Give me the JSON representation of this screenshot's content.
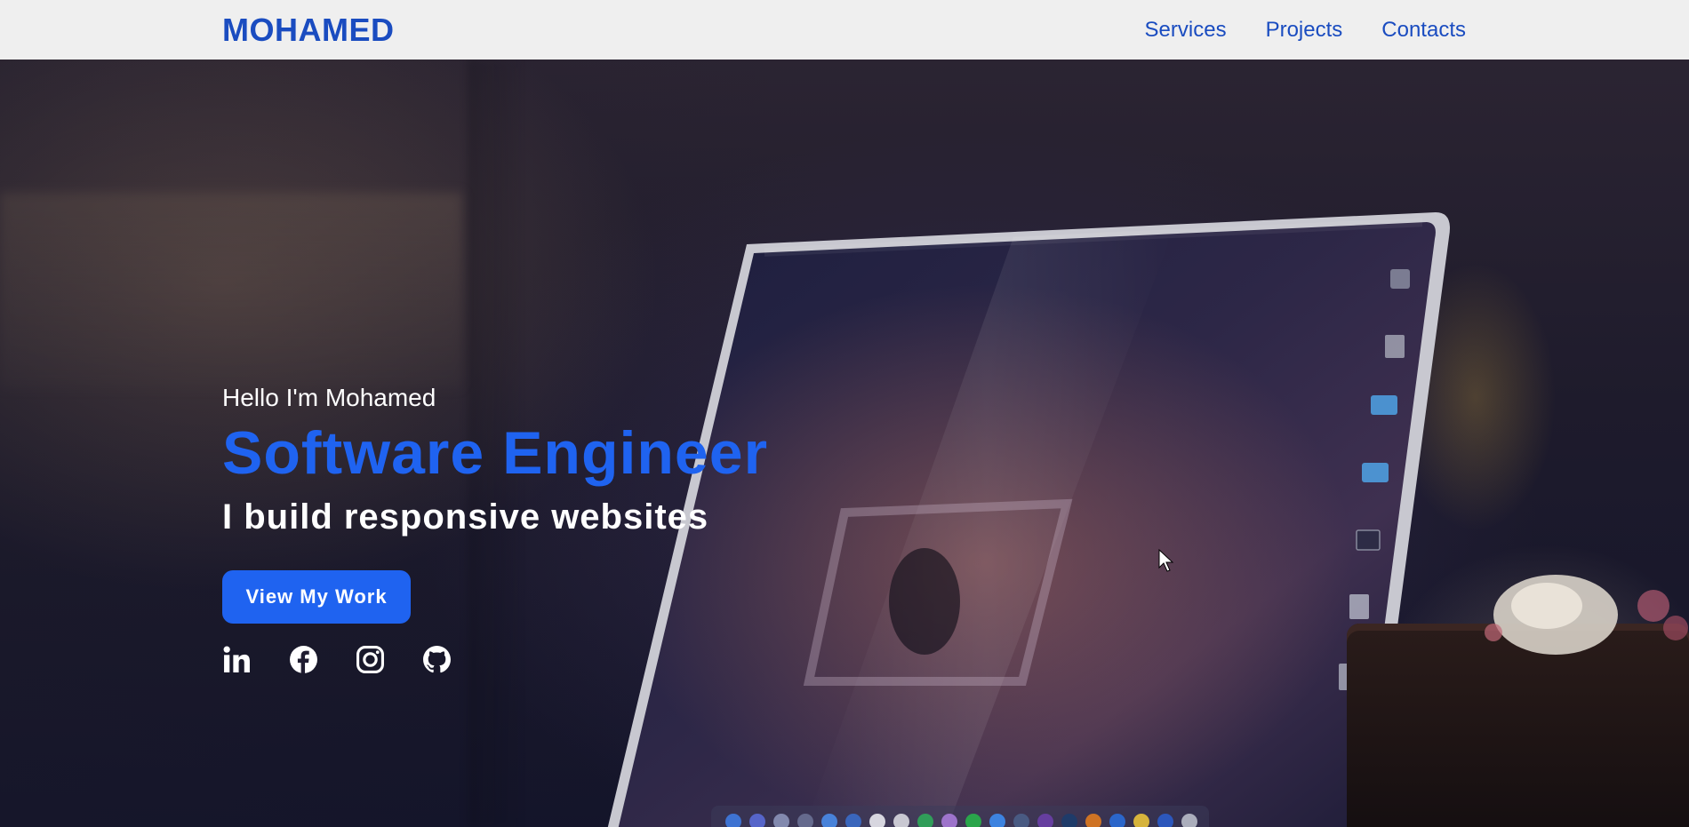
{
  "header": {
    "brand": "MOHAMED",
    "nav": [
      {
        "label": "Services"
      },
      {
        "label": "Projects"
      },
      {
        "label": "Contacts"
      }
    ]
  },
  "hero": {
    "greeting": "Hello I'm Mohamed",
    "role": "Software Engineer",
    "tagline": "I build responsive websites",
    "cta_label": "View My Work",
    "socials": [
      {
        "icon": "linkedin-icon"
      },
      {
        "icon": "facebook-icon"
      },
      {
        "icon": "instagram-icon"
      },
      {
        "icon": "github-icon"
      }
    ]
  },
  "colors": {
    "accent": "#1f63f0",
    "brand": "#1a4cc0",
    "navbar_bg": "#efefef",
    "text_light": "#ffffff"
  }
}
